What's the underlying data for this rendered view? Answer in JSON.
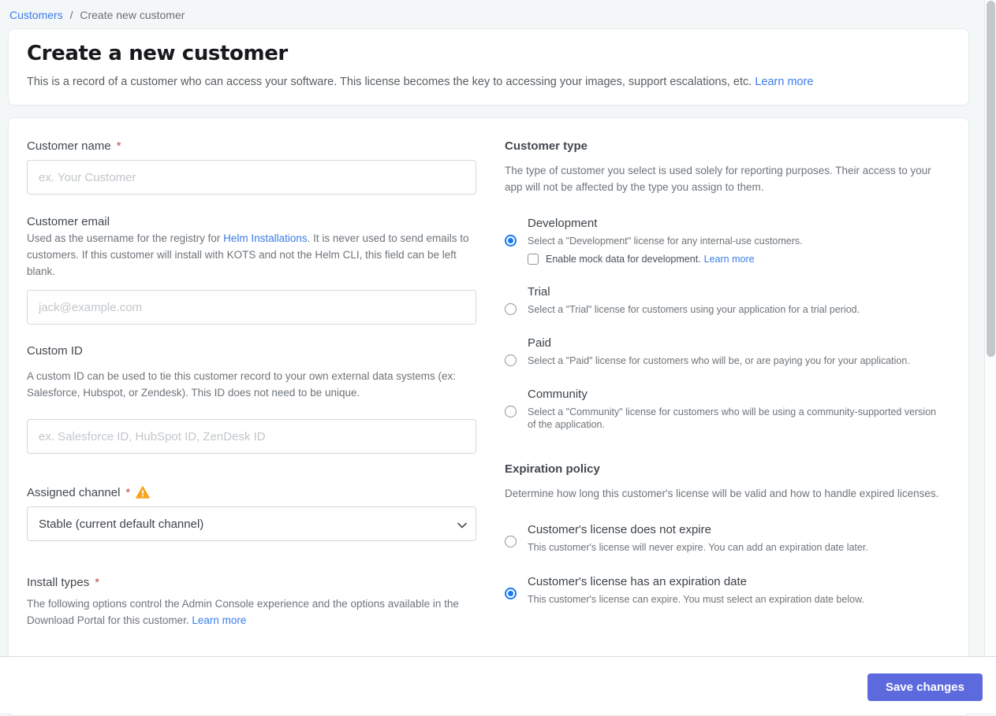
{
  "breadcrumb": {
    "link": "Customers",
    "separator": "/",
    "current": "Create new customer"
  },
  "header": {
    "title": "Create a new customer",
    "description": "This is a record of a customer who can access your software. This license becomes the key to accessing your images, support escalations, etc. ",
    "learn_more": "Learn more"
  },
  "form": {
    "customer_name": {
      "label": "Customer name",
      "required": "*",
      "value": "",
      "placeholder": "ex. Your Customer"
    },
    "customer_email": {
      "label": "Customer email",
      "desc_before": "Used as the username for the registry for ",
      "desc_link": "Helm Installations",
      "desc_after": ". It is never used to send emails to customers. If this customer will install with KOTS and not the Helm CLI, this field can be left blank.",
      "value": "",
      "placeholder": "jack@example.com"
    },
    "custom_id": {
      "label": "Custom ID",
      "description": "A custom ID can be used to tie this customer record to your own external data systems (ex: Salesforce, Hubspot, or Zendesk). This ID does not need to be unique.",
      "value": "",
      "placeholder": "ex. Salesforce ID, HubSpot ID, ZenDesk ID"
    },
    "assigned_channel": {
      "label": "Assigned channel",
      "required": "*",
      "selected_option": "Stable (current default channel)"
    },
    "install_types": {
      "label": "Install types",
      "required": "*",
      "description": "The following options control the Admin Console experience and the options available in the Download Portal for this customer. ",
      "learn_more": "Learn more"
    }
  },
  "customer_type": {
    "heading": "Customer type",
    "description": "The type of customer you select is used solely for reporting purposes. Their access to your app will not be affected by the type you assign to them.",
    "options": [
      {
        "label": "Development",
        "description": "Select a \"Development\" license for any internal-use customers.",
        "selected": true,
        "checkbox_label": "Enable mock data for development.",
        "checkbox_learn_more": "Learn more",
        "checkbox_checked": false
      },
      {
        "label": "Trial",
        "description": "Select a \"Trial\" license for customers using your application for a trial period.",
        "selected": false
      },
      {
        "label": "Paid",
        "description": "Select a \"Paid\" license for customers who will be, or are paying you for your application.",
        "selected": false
      },
      {
        "label": "Community",
        "description": "Select a \"Community\" license for customers who will be using a community-supported version of the application.",
        "selected": false
      }
    ]
  },
  "expiration_policy": {
    "heading": "Expiration policy",
    "description": "Determine how long this customer's license will be valid and how to handle expired licenses.",
    "options": [
      {
        "label": "Customer's license does not expire",
        "description": "This customer's license will never expire. You can add an expiration date later.",
        "selected": false
      },
      {
        "label": "Customer's license has an expiration date",
        "description": "This customer's license can expire. You must select an expiration date below.",
        "selected": true
      }
    ]
  },
  "footer": {
    "save_label": "Save changes"
  },
  "icons": {
    "assigned_channel_warning": "warning-triangle-icon",
    "select_chevron": "chevron-down-icon"
  },
  "colors": {
    "page_background": "#f4f7f8",
    "link_blue": "#3b7ce8",
    "radio_selected_blue": "#1879f2",
    "save_button": "#5c6ade",
    "warning_amber": "#f7a41f",
    "required_red": "#bc4b4b"
  }
}
